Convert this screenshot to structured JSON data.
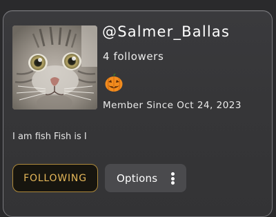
{
  "profile": {
    "username": "@Salmer_Ballas",
    "followers": "4 followers",
    "badge_icon": "jack-o-lantern-icon",
    "member_since": "Member Since Oct 24, 2023",
    "bio": "I am fish Fish is I"
  },
  "actions": {
    "following_label": "FOLLOWING",
    "options_label": "Options",
    "options_icon": "kebab-menu-icon"
  },
  "colors": {
    "following_accent": "#e6b85a",
    "card_background": "#373739",
    "page_background": "#2a2a2c"
  }
}
